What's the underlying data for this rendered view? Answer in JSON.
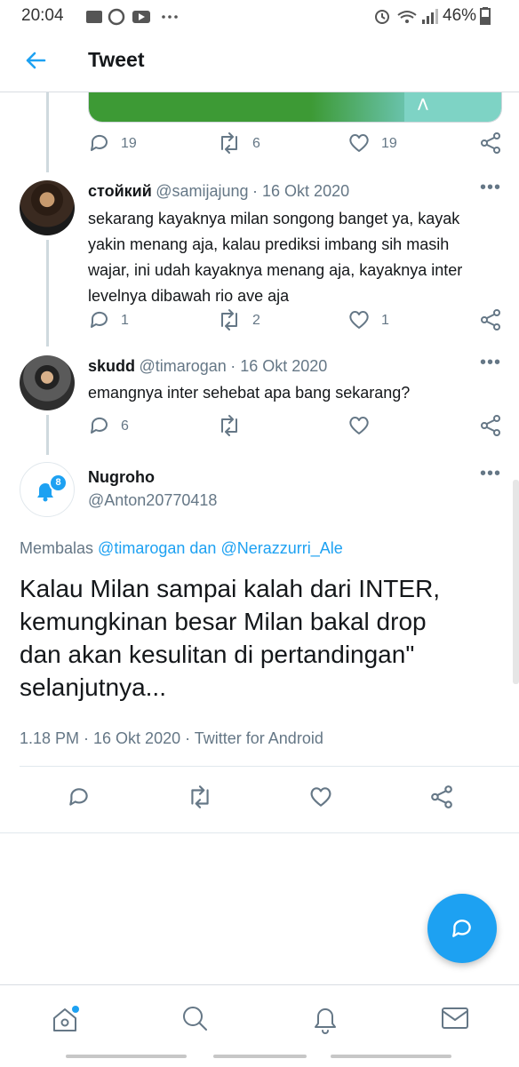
{
  "status_bar": {
    "time": "20:04",
    "battery": "46%"
  },
  "header": {
    "title": "Tweet"
  },
  "media_tweet": {
    "actions": {
      "reply_count": "19",
      "retweet_count": "6",
      "like_count": "19"
    }
  },
  "replies": [
    {
      "name": "стойкий",
      "handle": "@samijajung",
      "date": "· 16 Okt 2020",
      "text_lines": [
        "sekarang kayaknya milan songong banget ya, kayak",
        "yakin menang aja, kalau prediksi imbang sih masih",
        "wajar, ini udah kayaknya menang aja, kayaknya inter",
        "levelnya dibawah rio ave aja"
      ],
      "reply_count": "1",
      "retweet_count": "2",
      "like_count": "1"
    },
    {
      "name": "skudd",
      "handle": "@timarogan",
      "date": "· 16 Okt 2020",
      "text_lines": [
        "emangnya inter sehebat apa bang sekarang?"
      ],
      "reply_count": "6",
      "retweet_count": "",
      "like_count": ""
    }
  ],
  "main_tweet": {
    "name": "Nugroho",
    "handle": "@Anton20770418",
    "avatar_badge": "8",
    "replying_prefix": "Membalas",
    "replying_to_1": "@timarogan",
    "replying_and": "dan",
    "replying_to_2": "@Nerazzurri_Ale",
    "text_lines": [
      "Kalau Milan sampai kalah dari INTER,",
      "kemungkinan besar Milan bakal drop",
      "dan akan kesulitan di pertandingan\"",
      "selanjutnya..."
    ],
    "meta": "1.18 PM · 16 Okt 2020 · Twitter for Android"
  },
  "colors": {
    "accent": "#1da1f2",
    "muted": "#657786",
    "text": "#14171a"
  },
  "icons": {
    "back": "arrow-left-icon",
    "reply": "reply-icon",
    "retweet": "retweet-icon",
    "like": "heart-icon",
    "share": "share-icon",
    "compose": "compose-icon",
    "home": "home-icon",
    "search": "search-icon",
    "notifications": "bell-icon",
    "messages": "mail-icon"
  }
}
